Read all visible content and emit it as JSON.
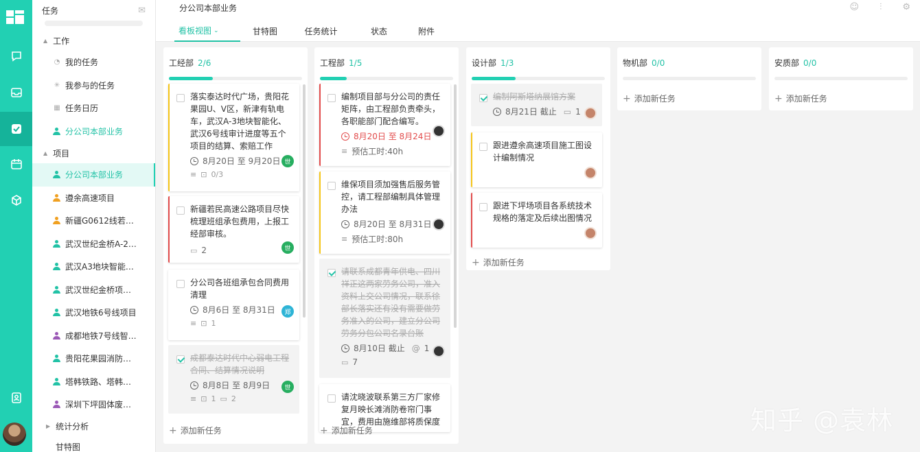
{
  "sidebar": {
    "header": "任务",
    "groups": {
      "work": "工作",
      "projects": "项目",
      "stats": "统计分析",
      "bottom": "甘特图"
    },
    "work_items": [
      {
        "label": "我的任务"
      },
      {
        "label": "我参与的任务"
      },
      {
        "label": "任务日历"
      },
      {
        "label": "分公司本部业务"
      }
    ],
    "project_items": [
      {
        "label": "分公司本部业务",
        "color": "#22c2a6"
      },
      {
        "label": "遵余高速项目",
        "color": "#f0a020"
      },
      {
        "label": "新疆G0612线若…",
        "color": "#f0a020"
      },
      {
        "label": "武汉世纪金桥A-2…",
        "color": "#22c2a6"
      },
      {
        "label": "武汉A3地块智能…",
        "color": "#22c2a6"
      },
      {
        "label": "武汉世纪金桥项…",
        "color": "#22c2a6"
      },
      {
        "label": "武汉地铁6号线项目",
        "color": "#22c2a6"
      },
      {
        "label": "成都地铁7号线智…",
        "color": "#9b59b6"
      },
      {
        "label": "贵阳花果园消防…",
        "color": "#22c2a6"
      },
      {
        "label": "塔韩铁路、塔韩…",
        "color": "#22c2a6"
      },
      {
        "label": "深圳下坪固体废…",
        "color": "#9b59b6"
      }
    ]
  },
  "header": {
    "title": "分公司本部业务",
    "tabs": [
      "看板视图",
      "甘特图",
      "任务统计",
      "状态",
      "附件"
    ]
  },
  "board": {
    "add_task": "添加新任务",
    "columns": [
      {
        "name": "工经部",
        "count": "2/6",
        "progress": 0.33,
        "cards": [
          {
            "title": "落实泰达时代广场，贵阳花果园U、V区，新津有轨电车，武汉A-3地块智能化、武汉6号线审计进度等五个项目的结算、索赔工作",
            "date": "8月20日 至 9月20日",
            "sub": "0/3",
            "avatar": "世",
            "stripe": "#f5c518",
            "done": false
          },
          {
            "title": "新疆若民高速公路项目尽快梳理班组承包费用，上报工经部审核。",
            "comments": "2",
            "avatar": "世",
            "stripe": "#e24b4b",
            "done": false
          },
          {
            "title": "分公司各班组承包合同费用清理",
            "date": "8月6日 至 8月31日",
            "sub": "1",
            "avatar": "郑",
            "stripe": "",
            "done": false
          },
          {
            "title": "成都泰达时代中心弱电工程合同、结算情况说明",
            "date": "8月8日 至 8月9日",
            "sub": "1",
            "comments": "2",
            "avatar": "世",
            "stripe": "",
            "done": true
          }
        ]
      },
      {
        "name": "工程部",
        "count": "1/5",
        "progress": 0.2,
        "cards": [
          {
            "title": "编制项目部与分公司的责任矩阵，由工程部负责牵头，各职能部门配合编写。",
            "date": "8月20日 至 8月24日",
            "estimate": "预估工时:40h",
            "stripe": "#e24b4b",
            "done": false,
            "red": true
          },
          {
            "title": "维保项目须加强售后服务管控，请工程部编制具体管理办法",
            "date": "8月20日 至 8月31日",
            "estimate": "预估工时:80h",
            "stripe": "#f5c518",
            "done": false
          },
          {
            "title": "请联系成都青年供电、四川祥正这两家劳务公司，准入资料上交公司情况，联系徐部长落实还有没有需要做劳务准入的公司，建立分公司劳务分包公司名录台账",
            "date": "8月10日 截止",
            "sub": "1",
            "comments": "7",
            "stripe": "",
            "done": true
          },
          {
            "title": "请沈晓波联系第三方厂家修复月映长滩消防卷帘门事宜，费用由施维部将质保度",
            "stripe": "",
            "done": false
          }
        ]
      },
      {
        "name": "设计部",
        "count": "1/3",
        "progress": 0.33,
        "cards": [
          {
            "title": "编制阿斯塔纳展馆方案",
            "date": "8月21日 截止",
            "comments": "1",
            "stripe": "",
            "done": true
          },
          {
            "title": "跟进遵余高速项目施工图设计编制情况",
            "stripe": "#f5c518",
            "done": false
          },
          {
            "title": "跟进下坪场项目各系统技术规格的落定及后续出图情况",
            "stripe": "#e24b4b",
            "done": false
          }
        ]
      },
      {
        "name": "物机部",
        "count": "0/0",
        "progress": 0,
        "cards": []
      },
      {
        "name": "安质部",
        "count": "0/0",
        "progress": 0,
        "cards": []
      }
    ]
  },
  "watermark": "知乎 @袁林",
  "colors": {
    "accent": "#22d0b3",
    "urgent": "#e24b4b",
    "warning": "#f5c518"
  }
}
